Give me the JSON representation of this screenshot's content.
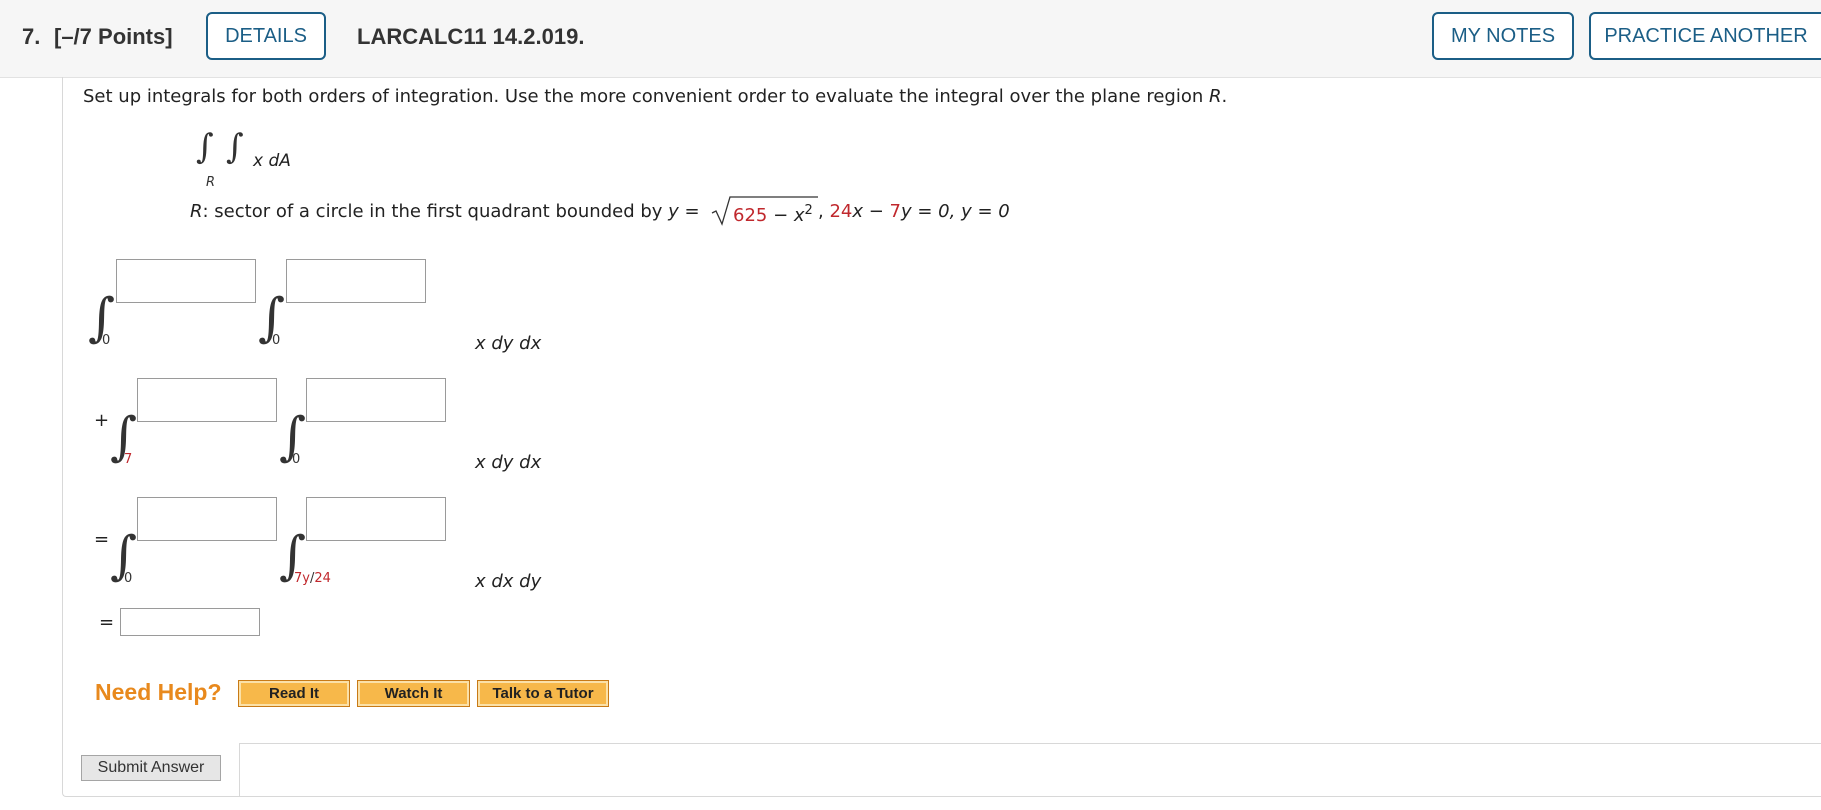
{
  "header": {
    "question_number": "7.",
    "points": "[–/7 Points]",
    "details_label": "DETAILS",
    "problem_code": "LARCALC11 14.2.019.",
    "my_notes_label": "MY NOTES",
    "practice_label": "PRACTICE ANOTHER"
  },
  "prompt": {
    "text": "Set up integrals for both orders of integration. Use the more convenient order to evaluate the integral over the plane region ",
    "region": "R",
    "period": "."
  },
  "integral_display": {
    "integrand": "x dA",
    "region_sub": "R"
  },
  "region_desc": {
    "prefix": "R",
    "text": ": sector of a circle in the first quadrant bounded by ",
    "y_eq": "y =",
    "sqrt_625": "625",
    "sqrt_minus": " − ",
    "sqrt_x2": "x",
    "sqrt_exp": "2",
    "comma1": ", ",
    "coef24": "24",
    "x_minus": "x − ",
    "coef7": "7",
    "y_tail": "y = 0, y = 0"
  },
  "row1": {
    "lower_outer": "0",
    "lower_inner": "0",
    "differential": "x dy dx"
  },
  "row2": {
    "operator": "+",
    "lower_outer": "7",
    "lower_inner": "0",
    "differential": "x dy dx"
  },
  "row3": {
    "operator": "=",
    "lower_outer": "0",
    "lower_inner_a": "7y",
    "lower_inner_sep": "/",
    "lower_inner_b": "24",
    "differential": "x dx dy"
  },
  "row4": {
    "operator": "="
  },
  "help": {
    "label": "Need Help?",
    "read_it": "Read It",
    "watch_it": "Watch It",
    "talk_tutor": "Talk to a Tutor"
  },
  "submit_label": "Submit Answer",
  "colors": {
    "accent_blue": "#1b5e86",
    "highlight_red": "#c0282d",
    "help_orange": "#e8891d"
  }
}
